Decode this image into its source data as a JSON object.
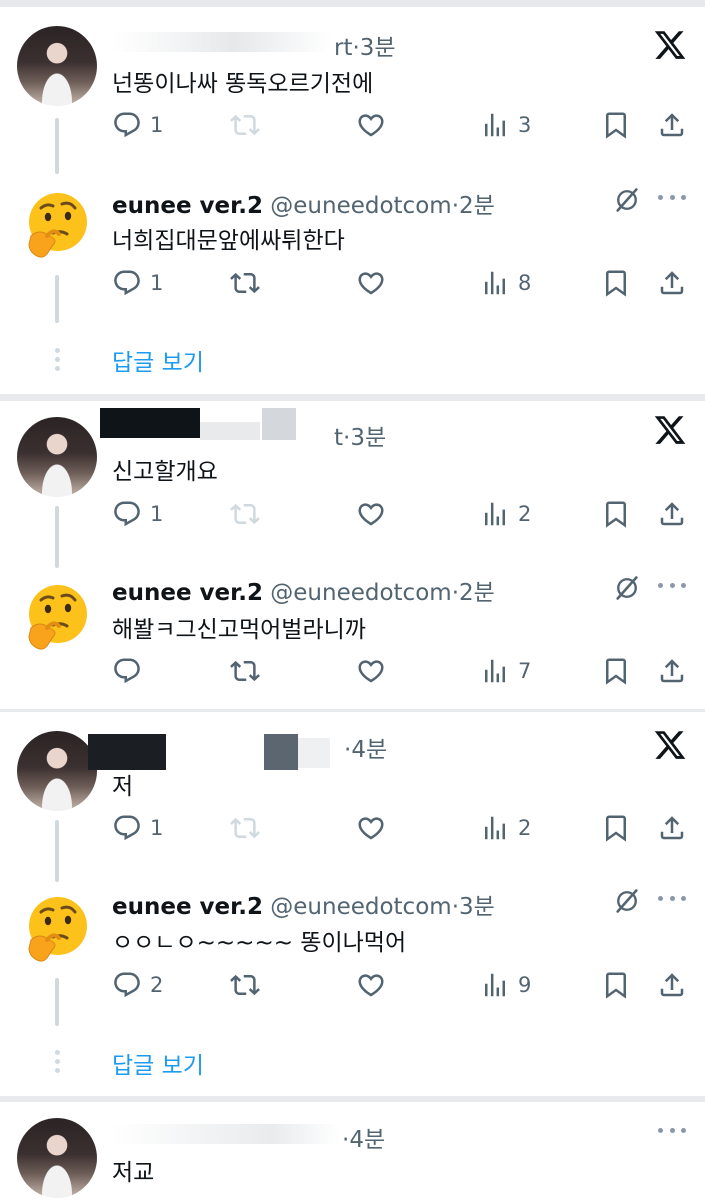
{
  "threads": [
    {
      "parent": {
        "name_tail": "rt",
        "time": "3분",
        "text": "넌똥이나싸 똥독오르기전에",
        "counts": {
          "reply": "1",
          "retweet": "",
          "like": "",
          "views": "3"
        }
      },
      "reply": {
        "name": "eunee ver.2",
        "handle": "@euneedotcom",
        "time": "2분",
        "text": "너희집대문앞에싸튀한다",
        "counts": {
          "reply": "1",
          "retweet": "",
          "like": "",
          "views": "8"
        }
      },
      "show_replies": "답글 보기"
    },
    {
      "parent": {
        "name_tail": "t",
        "time": "3분",
        "text": "신고할개요",
        "counts": {
          "reply": "1",
          "retweet": "",
          "like": "",
          "views": "2"
        }
      },
      "reply": {
        "name": "eunee ver.2",
        "handle": "@euneedotcom",
        "time": "2분",
        "text": "해봘ㅋ그신고먹어벌라니까",
        "counts": {
          "reply": "",
          "retweet": "",
          "like": "",
          "views": "7"
        }
      }
    },
    {
      "parent": {
        "name_tail": "",
        "time": "4분",
        "text": "저",
        "counts": {
          "reply": "1",
          "retweet": "",
          "like": "",
          "views": "2"
        }
      },
      "reply": {
        "name": "eunee ver.2",
        "handle": "@euneedotcom",
        "time": "3분",
        "text": "ㅇㅇㄴㅇ~~~~~ 똥이나먹어",
        "counts": {
          "reply": "2",
          "retweet": "",
          "like": "",
          "views": "9"
        }
      },
      "show_replies": "답글 보기"
    },
    {
      "parent": {
        "name_tail": "",
        "time": "4분",
        "text": "저교"
      }
    }
  ],
  "separator": "·",
  "icons": [
    "reply-icon",
    "retweet-icon",
    "like-icon",
    "views-icon",
    "bookmark-icon",
    "share-icon",
    "x-logo-icon",
    "grok-icon",
    "more-icon"
  ],
  "colors": {
    "text": "#0f1419",
    "muted": "#536471",
    "link": "#1d9bf0",
    "divider": "#e7e9ec",
    "thread_line": "#cfd9de"
  }
}
